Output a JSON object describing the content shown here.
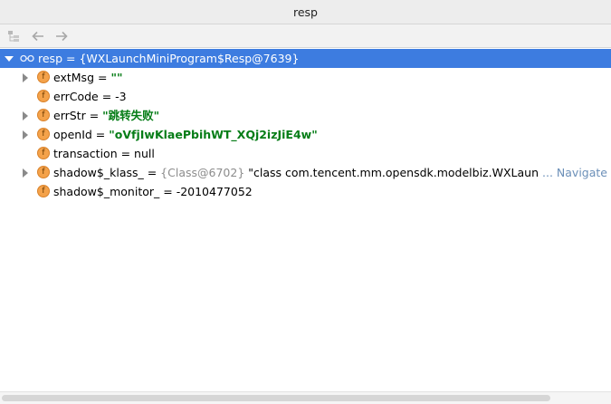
{
  "window": {
    "title": "resp"
  },
  "toolbar": {
    "icons": [
      "tree-view-icon",
      "back-arrow-icon",
      "forward-arrow-icon"
    ]
  },
  "tree": {
    "root": {
      "name": "resp",
      "eq": " = ",
      "value": "{WXLaunchMiniProgram$Resp@7639}"
    },
    "fields": [
      {
        "name": "extMsg",
        "eq": " = ",
        "value": "\"\"",
        "kind": "string",
        "expandable": true
      },
      {
        "name": "errCode",
        "eq": " = ",
        "value": "-3",
        "kind": "plain",
        "expandable": false
      },
      {
        "name": "errStr",
        "eq": " = ",
        "value": "\"跳转失败\"",
        "kind": "string",
        "expandable": true
      },
      {
        "name": "openId",
        "eq": " = ",
        "value": "\"oVfjIwKlaePbihWT_XQj2izJiE4w\"",
        "kind": "string",
        "expandable": true
      },
      {
        "name": "transaction",
        "eq": " = ",
        "value": "null",
        "kind": "plain",
        "expandable": false
      },
      {
        "name": "shadow$_klass_",
        "eq": " = ",
        "class_ref": "{Class@6702}",
        "value": " \"class com.tencent.mm.opensdk.modelbiz.WXLaunchMiniProg",
        "kind": "class",
        "expandable": true,
        "link": "... Navigate"
      },
      {
        "name": "shadow$_monitor_",
        "eq": " = ",
        "value": "-2010477052",
        "kind": "plain",
        "expandable": false
      }
    ]
  },
  "colors": {
    "selection": "#3d7ce0",
    "string_value": "#067d17",
    "field_icon": "#f4a24a",
    "link": "#6b8fb8"
  }
}
